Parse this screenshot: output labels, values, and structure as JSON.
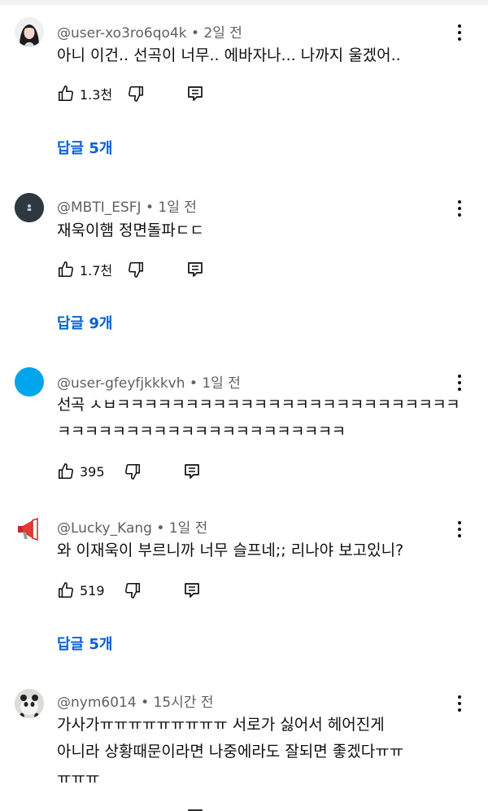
{
  "comments": [
    {
      "author": "@user-xo3ro6qo4k",
      "time": "2일 전",
      "lines": [
        "아니 이건.. 선곡이 너무.. 에바자나... 나까지 울겠어.."
      ],
      "likes": "1.3천",
      "replies": "답글 5개"
    },
    {
      "author": "@MBTI_ESFJ",
      "time": "1일 전",
      "lines": [
        "재욱이햄 정면돌파ㄷㄷ"
      ],
      "likes": "1.7천",
      "replies": "답글 9개"
    },
    {
      "author": "@user-gfeyfjkkkvh",
      "time": "1일 전",
      "lines": [
        "선곡 ㅅㅂㅋㅋㅋㅋㅋㅋㅋㅋㅋㅋㅋㅋㅋㅋㅋㅋㅋㅋㅋㅋㅋㅋㅋㅋㅋ",
        "ㅋㅋㅋㅋㅋㅋㅋㅋㅋㅋㅋㅋㅋㅋㅋㅋㅋㅋㅋㅋㅋ"
      ],
      "likes": "395",
      "replies": ""
    },
    {
      "author": "@Lucky_Kang",
      "time": "1일 전",
      "lines": [
        "와 이재욱이 부르니까 너무 슬프네;; 리나야 보고있니?"
      ],
      "likes": "519",
      "replies": "답글 5개"
    },
    {
      "author": "@nym6014",
      "time": "15시간 전",
      "lines": [
        "가사가ㅠㅠㅠㅠㅠㅠㅠㅠㅠ 서로가 싫어서 헤어진게",
        "아니라 상황때문이라면 나중에라도 잘되면 좋겠다ㅠㅠ",
        "ㅠㅠㅠ"
      ],
      "likes": "",
      "replies": ""
    }
  ],
  "icons": {
    "like": "thumbs-up-icon",
    "dislike": "thumbs-down-icon",
    "reply": "reply-icon",
    "more": "more-vertical-icon"
  },
  "colors": {
    "link": "#065fd4",
    "meta": "#606060",
    "avatar3": "#00a5ec"
  }
}
